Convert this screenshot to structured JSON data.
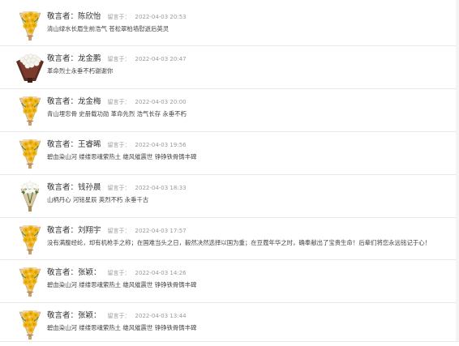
{
  "messages": [
    {
      "author_label": "敬言者：",
      "author": "陈欣怡",
      "time_label": "留言于：",
      "time": "2022-04-03 20:53",
      "content": "清山绿水长眉生前浩气 苍松翠柏墙慰逝后英灵",
      "flower": "chrysanthemum-bouquet-icon"
    },
    {
      "author_label": "敬言者：",
      "author": "龙金鹏",
      "time_label": "留言于：",
      "time": "2022-04-03 20:47",
      "content": "革命烈士永垂不朽谢谢你",
      "flower": "white-rose-bouquet-icon"
    },
    {
      "author_label": "敬言者：",
      "author": "龙金梅",
      "time_label": "留言于：",
      "time": "2022-04-03 20:00",
      "content": "青山埋忠骨 史册载功勋 革命先烈 浩气长存 永垂不朽",
      "flower": "chrysanthemum-bouquet-icon"
    },
    {
      "author_label": "敬言者：",
      "author": "王睿晞",
      "time_label": "留言于：",
      "time": "2022-04-03 19:56",
      "content": "碧血染山河 缕缕思魂萦热土 雄风催震世 铮铮铁骨铸丰碑",
      "flower": "chrysanthemum-bouquet-icon"
    },
    {
      "author_label": "敬言者：",
      "author": "钱孙晨",
      "time_label": "留言于：",
      "time": "2022-04-03 18:33",
      "content": "山柄丹心 河铭星辰 英烈不朽 永垂千古",
      "flower": "lily-bouquet-icon"
    },
    {
      "author_label": "敬言者：",
      "author": "刘翔宇",
      "time_label": "留言于：",
      "time": "2022-04-03 17:57",
      "content": "没有满腹经纶，却有机枪手之称；在国难当头之日，毅然决然选择以国为重；在豆蔻年华之时，确奉献出了宝贵生命！后辈们将您永远铭记于心！",
      "flower": "chrysanthemum-bouquet-icon"
    },
    {
      "author_label": "敬言者：",
      "author": "张颖：",
      "time_label": "留言于：",
      "time": "2022-04-03 14:26",
      "content": "碧血染山河 缕缕思魂萦热土 雄风催震世 铮铮铁骨铸丰碑",
      "flower": "chrysanthemum-bouquet-icon"
    },
    {
      "author_label": "敬言者：",
      "author": "张颖：",
      "time_label": "留言于：",
      "time": "2022-04-03 13:44",
      "content": "碧血染山河 缕缕思魂萦热土 雄风催震世 铮铮铁骨铸丰碑",
      "flower": "chrysanthemum-bouquet-icon"
    }
  ],
  "colors": {
    "author_text": "#333333",
    "time_text": "#9a9a9a",
    "content_text": "#444444",
    "divider": "#e9e9e9",
    "chrysanthemum": "#f1b817",
    "wrap_paper": "#d9b98a"
  }
}
